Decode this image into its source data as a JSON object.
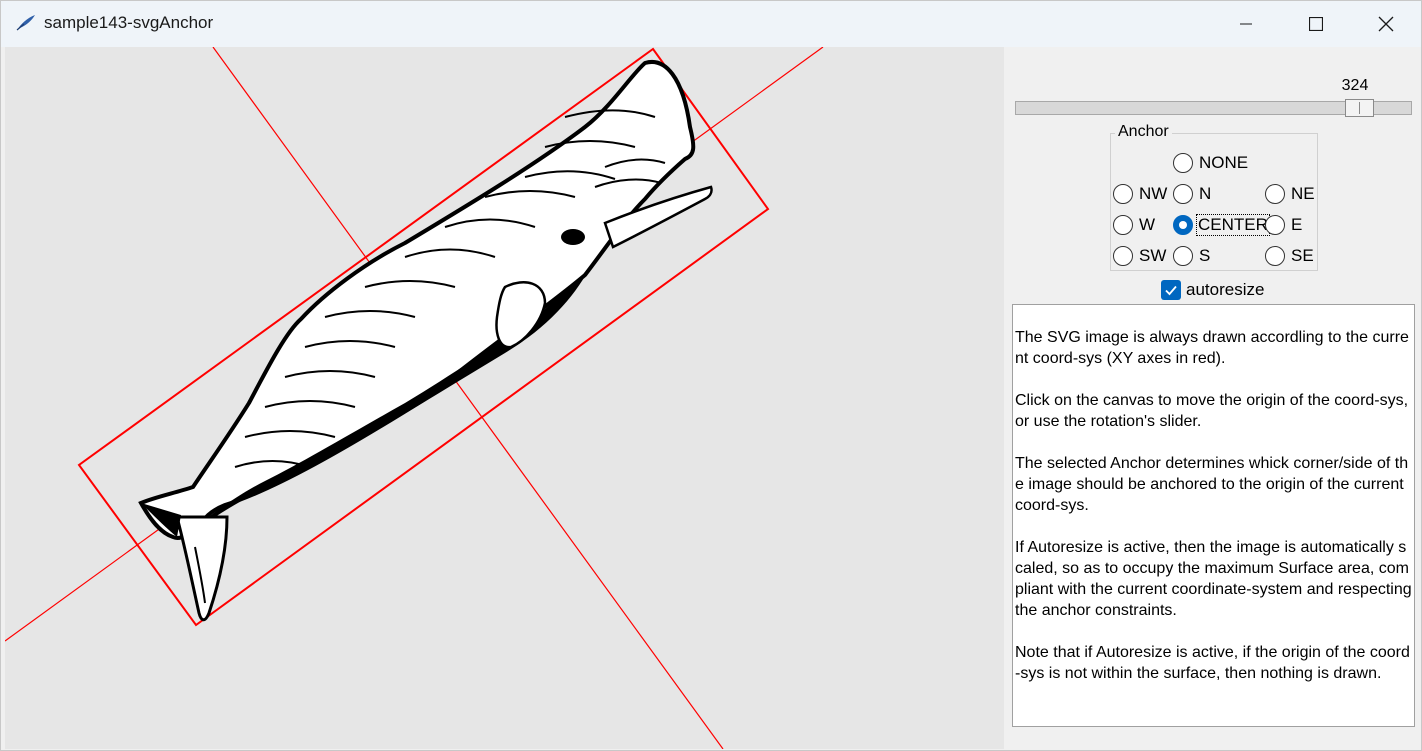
{
  "window": {
    "title": "sample143-svgAnchor",
    "icon": "feather-icon"
  },
  "colors": {
    "accent": "#0067c0",
    "axes": "#ff0000",
    "canvas_bg": "#e6e6e6"
  },
  "rotation": {
    "value": "324",
    "value_fraction": 0.9
  },
  "anchor": {
    "legend": "Anchor",
    "options": [
      "NONE",
      "NW",
      "N",
      "NE",
      "W",
      "CENTER",
      "E",
      "SW",
      "S",
      "SE"
    ],
    "selected": "CENTER"
  },
  "autoresize": {
    "label": "autoresize",
    "checked": true
  },
  "help": {
    "paragraphs": [
      "The SVG image is always drawn accordling to the current coord-sys (XY axes in red).",
      "Click on the canvas to move the origin of the coord-sys, or use the rotation's slider.",
      "The selected Anchor determines whick corner/side of the image should be anchored to the origin of the current coord-sys.",
      "If Autoresize is active, then the image is automatically scaled, so as to occupy the maximum Surface area, compliant with the current coordinate-system and respecting the anchor constraints.",
      "Note that if Autoresize is active, if the origin of the coord-sys is not within the surface, then nothing is drawn."
    ]
  }
}
